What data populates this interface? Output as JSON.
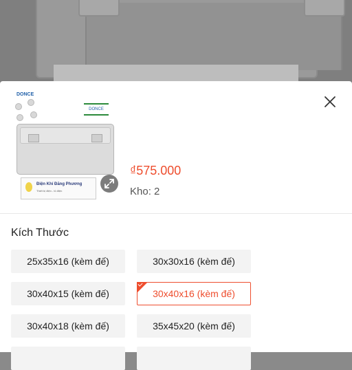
{
  "product": {
    "price": "₫575.000",
    "stock_label": "Kho: 2",
    "thumb_brand": "DONCE",
    "thumb_sticker_title": "Điện Khí Đăng Phương",
    "thumb_sticker_sub": "Thiết bị điện - tủ điện"
  },
  "variation": {
    "section_title": "Kích Thước",
    "options": [
      {
        "label": "25x35x16 (kèm đế)",
        "selected": false
      },
      {
        "label": "30x30x16 (kèm đế)",
        "selected": false
      },
      {
        "label": "30x40x15 (kèm đế)",
        "selected": false
      },
      {
        "label": "30x40x16 (kèm đế)",
        "selected": true
      },
      {
        "label": "30x40x18 (kèm đế)",
        "selected": false
      },
      {
        "label": "35x45x20 (kèm đế)",
        "selected": false
      }
    ]
  },
  "icons": {
    "close": "close-icon",
    "zoom": "expand-icon",
    "selected_check": "check-icon"
  },
  "colors": {
    "accent": "#ee4d2d",
    "option_bg": "#f3f3f3",
    "text": "#222222"
  }
}
